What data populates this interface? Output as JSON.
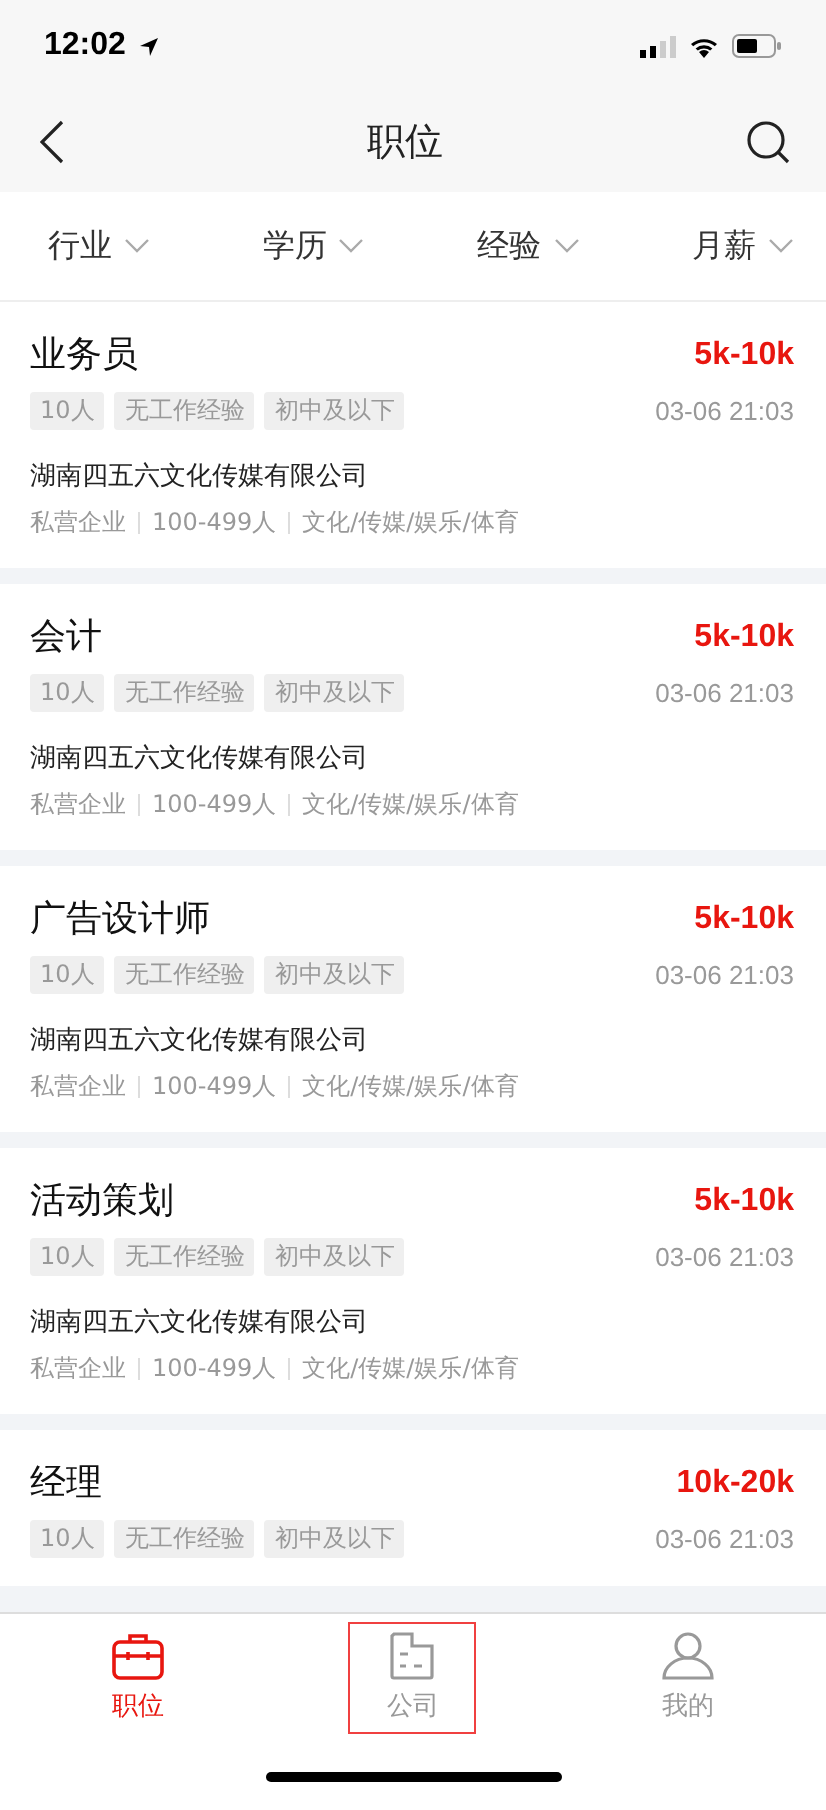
{
  "status_bar": {
    "time": "12:02"
  },
  "nav": {
    "title": "职位"
  },
  "filters": [
    {
      "label": "行业"
    },
    {
      "label": "学历"
    },
    {
      "label": "经验"
    },
    {
      "label": "月薪"
    }
  ],
  "jobs": [
    {
      "title": "业务员",
      "salary": "5k-10k",
      "tags": [
        "10人",
        "无工作经验",
        "初中及以下"
      ],
      "time": "03-06 21:03",
      "company": "湖南四五六文化传媒有限公司",
      "meta": [
        "私营企业",
        "100-499人",
        "文化/传媒/娱乐/体育"
      ]
    },
    {
      "title": "会计",
      "salary": "5k-10k",
      "tags": [
        "10人",
        "无工作经验",
        "初中及以下"
      ],
      "time": "03-06 21:03",
      "company": "湖南四五六文化传媒有限公司",
      "meta": [
        "私营企业",
        "100-499人",
        "文化/传媒/娱乐/体育"
      ]
    },
    {
      "title": "广告设计师",
      "salary": "5k-10k",
      "tags": [
        "10人",
        "无工作经验",
        "初中及以下"
      ],
      "time": "03-06 21:03",
      "company": "湖南四五六文化传媒有限公司",
      "meta": [
        "私营企业",
        "100-499人",
        "文化/传媒/娱乐/体育"
      ]
    },
    {
      "title": "活动策划",
      "salary": "5k-10k",
      "tags": [
        "10人",
        "无工作经验",
        "初中及以下"
      ],
      "time": "03-06 21:03",
      "company": "湖南四五六文化传媒有限公司",
      "meta": [
        "私营企业",
        "100-499人",
        "文化/传媒/娱乐/体育"
      ]
    },
    {
      "title": "经理",
      "salary": "10k-20k",
      "tags": [
        "10人",
        "无工作经验",
        "初中及以下"
      ],
      "time": "03-06 21:03"
    }
  ],
  "tab_bar": [
    {
      "kind": "briefcase",
      "label": "职位",
      "selected": true,
      "outlined": false
    },
    {
      "kind": "company",
      "label": "公司",
      "selected": false,
      "outlined": true
    },
    {
      "kind": "person",
      "label": "我的",
      "selected": false,
      "outlined": false
    }
  ]
}
